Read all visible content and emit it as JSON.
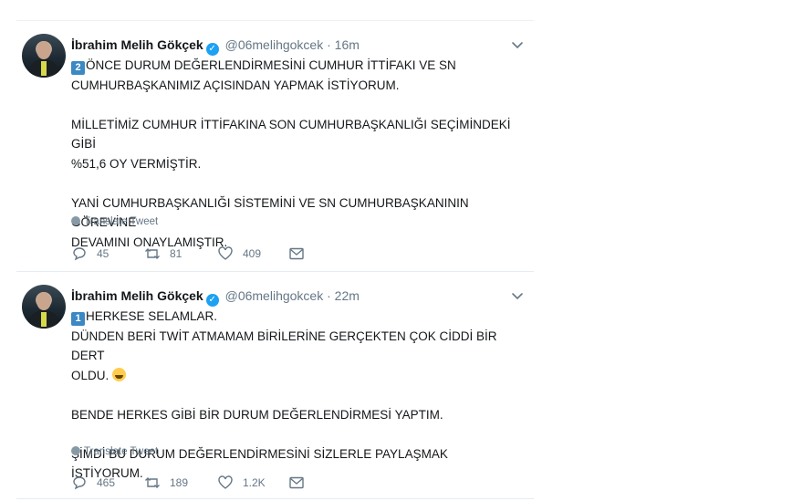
{
  "tweets": [
    {
      "author_name": "İbrahim Melih Gökçek",
      "verified_mark": "✓",
      "handle": "@06melihgokcek",
      "separator": "·",
      "time": "16m",
      "badge": "2",
      "lines": [
        "ÖNCE DURUM DEĞERLENDİRMESİNİ CUMHUR İTTİFAKI VE SN",
        "CUMHURBAŞKANIMIZ AÇISINDAN YAPMAK İSTİYORUM.",
        "",
        "MİLLETİMİZ CUMHUR İTTİFAKINA SON CUMHURBAŞKANLIĞI SEÇİMİNDEKİ GİBİ",
        "%51,6 OY VERMİŞTİR.",
        "",
        "YANİ CUMHURBAŞKANLIĞI SİSTEMİNİ VE SN CUMHURBAŞKANININ GÖREVİNE",
        "DEVAMINI ONAYLAMIŞTIR."
      ],
      "translate_label": "Translate Tweet",
      "replies": "45",
      "retweets": "81",
      "likes": "409"
    },
    {
      "author_name": "İbrahim Melih Gökçek",
      "verified_mark": "✓",
      "handle": "@06melihgokcek",
      "separator": "·",
      "time": "22m",
      "badge": "1",
      "lines": [
        "HERKESE SELAMLAR.",
        "DÜNDEN BERİ TWİT ATMAMAM BİRİLERİNE GERÇEKTEN ÇOK CİDDİ BİR DERT",
        "OLDU.",
        "",
        "BENDE HERKES GİBİ BİR DURUM DEĞERLENDİRMESİ YAPTIM.",
        "",
        "ŞİMDİ BU DURUM DEĞERLENDİRMESİNİ SİZLERLE PAYLAŞMAK İSTİYORUM."
      ],
      "emoji_icon": "face-with-tears-of-joy-icon",
      "translate_label": "Translate Tweet",
      "replies": "465",
      "retweets": "189",
      "likes": "1.2K"
    }
  ],
  "colors": {
    "accent": "#1da1f2",
    "muted": "#657786",
    "text": "#14171a",
    "keycap": "#3b88c3"
  }
}
